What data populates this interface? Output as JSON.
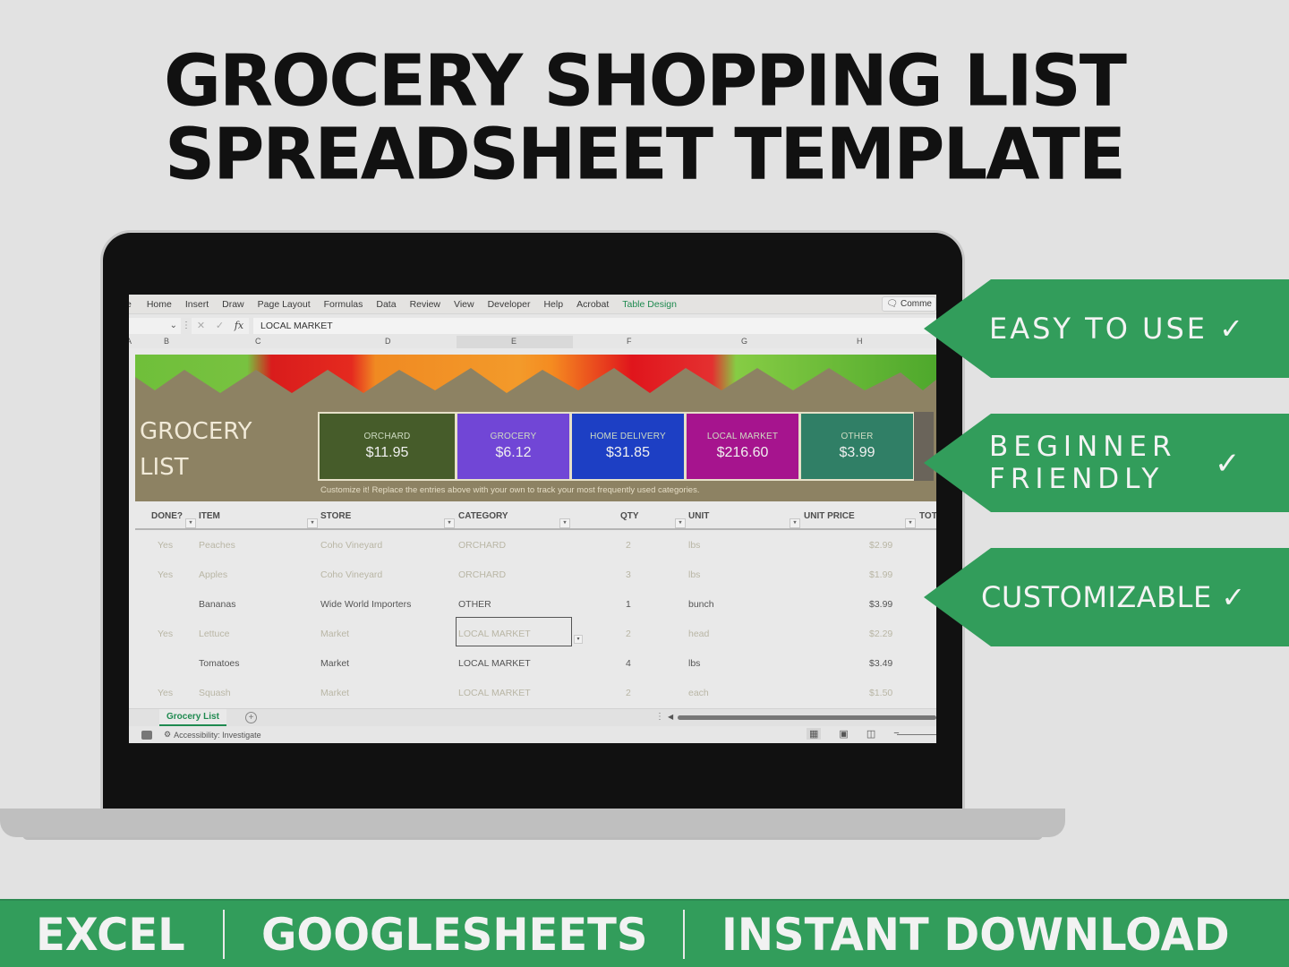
{
  "headline": {
    "line1": "GROCERY SHOPPING LIST",
    "line2": "SPREADSHEET TEMPLATE"
  },
  "excel": {
    "ribbon_tabs": [
      "e",
      "Home",
      "Insert",
      "Draw",
      "Page Layout",
      "Formulas",
      "Data",
      "Review",
      "View",
      "Developer",
      "Help",
      "Acrobat",
      "Table Design"
    ],
    "active_ribbon_tab": "Table Design",
    "comments_label": "Comme",
    "formula_bar": {
      "value": "LOCAL MARKET",
      "fx_label": "fx",
      "cancel_icon": "✕",
      "enter_icon": "✓"
    },
    "columns": [
      "A",
      "B",
      "C",
      "D",
      "E",
      "F",
      "G",
      "H"
    ],
    "banner": {
      "title_line1": "GROCERY",
      "title_line2": "LIST",
      "caption": "Customize it! Replace the entries above with your own to track your most frequently used categories.",
      "cards": [
        {
          "label": "ORCHARD",
          "amount": "$11.95",
          "color": "#465c2a"
        },
        {
          "label": "GROCERY",
          "amount": "$6.12",
          "color": "#7146d6"
        },
        {
          "label": "HOME DELIVERY",
          "amount": "$31.85",
          "color": "#1d3fc4"
        },
        {
          "label": "LOCAL MARKET",
          "amount": "$216.60",
          "color": "#a6148e"
        },
        {
          "label": "OTHER",
          "amount": "$3.99",
          "color": "#307f66"
        }
      ]
    },
    "table": {
      "headers": [
        "DONE?",
        "ITEM",
        "STORE",
        "CATEGORY",
        "QTY",
        "UNIT",
        "UNIT PRICE",
        "TOT"
      ],
      "rows": [
        {
          "done": "Yes",
          "item": "Peaches",
          "store": "Coho Vineyard",
          "category": "ORCHARD",
          "qty": "2",
          "unit": "lbs",
          "price": "$2.99",
          "completed": true
        },
        {
          "done": "Yes",
          "item": "Apples",
          "store": "Coho Vineyard",
          "category": "ORCHARD",
          "qty": "3",
          "unit": "lbs",
          "price": "$1.99",
          "completed": true
        },
        {
          "done": "",
          "item": "Bananas",
          "store": "Wide World Importers",
          "category": "OTHER",
          "qty": "1",
          "unit": "bunch",
          "price": "$3.99",
          "completed": false
        },
        {
          "done": "Yes",
          "item": "Lettuce",
          "store": "Market",
          "category": "LOCAL MARKET",
          "qty": "2",
          "unit": "head",
          "price": "$2.29",
          "completed": true
        },
        {
          "done": "",
          "item": "Tomatoes",
          "store": "Market",
          "category": "LOCAL MARKET",
          "qty": "4",
          "unit": "lbs",
          "price": "$3.49",
          "completed": false
        },
        {
          "done": "Yes",
          "item": "Squash",
          "store": "Market",
          "category": "LOCAL MARKET",
          "qty": "2",
          "unit": "each",
          "price": "$1.50",
          "completed": true
        }
      ]
    },
    "sheet_tab": "Grocery List",
    "status": {
      "accessibility": "Accessibility: Investigate"
    }
  },
  "badges": [
    {
      "text": "EASY TO USE ✓"
    },
    {
      "line1": "BEGINNER",
      "line2": "FRIENDLY",
      "check": "✓"
    },
    {
      "text": "CUSTOMIZABLE ✓"
    }
  ],
  "footer": {
    "items": [
      "EXCEL",
      "GOOGLESHEETS",
      "INSTANT DOWNLOAD"
    ]
  },
  "colors": {
    "accent_green": "#329d5b",
    "banner_khaki": "#8d8263",
    "laptop_bezel": "#111111"
  }
}
